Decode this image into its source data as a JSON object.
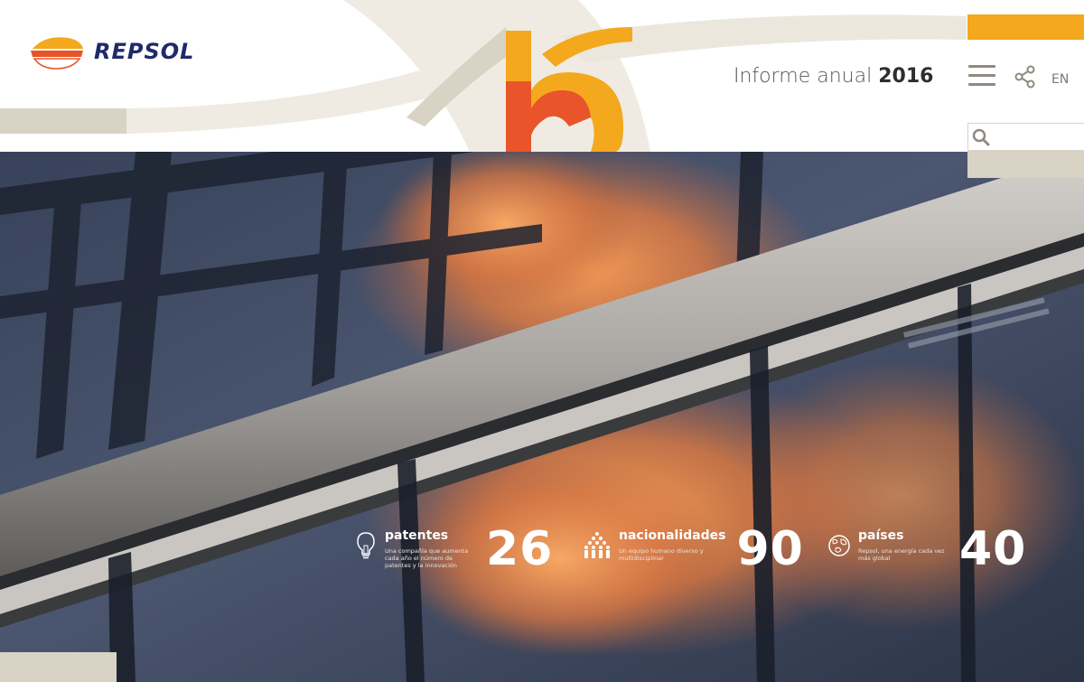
{
  "brand": {
    "name": "REPSOL"
  },
  "header": {
    "title_prefix": "Informe anual",
    "title_year": "2016",
    "lang_label": "EN",
    "menu_icon": "hamburger-icon",
    "share_icon": "share-icon"
  },
  "search": {
    "placeholder": "",
    "icon": "search-icon"
  },
  "colors": {
    "accent_orange": "#f4a81d",
    "accent_red": "#e9542a",
    "beige": "#d9d3c5",
    "brand_navy": "#1f2a6b"
  },
  "stats": [
    {
      "label": "patentes",
      "desc": "Una compañía que aumenta cada año el número de patentes y la innovación",
      "value": "26",
      "icon": "lightbulb-icon"
    },
    {
      "label": "nacionalidades",
      "desc": "Un equipo humano diverso y multidisciplinar",
      "value": "90",
      "icon": "people-group-icon"
    },
    {
      "label": "países",
      "desc": "Repsol, una energía cada vez más global",
      "value": "40",
      "icon": "globe-icon"
    }
  ]
}
